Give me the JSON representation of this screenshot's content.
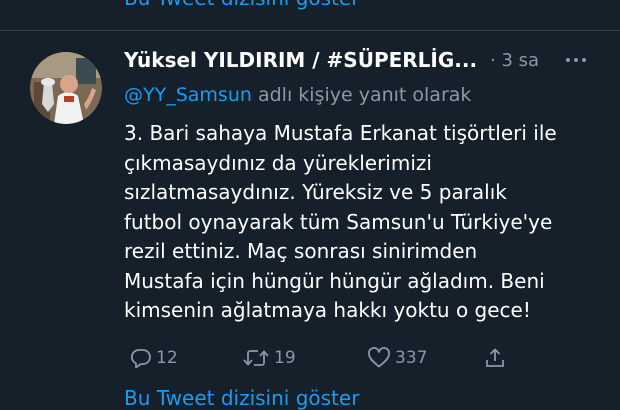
{
  "thread": {
    "top_link": "Bu Tweet dizisini göster",
    "bottom_link": "Bu Tweet dizisini göster"
  },
  "tweet": {
    "author_name": "Yüksel YILDIRIM / #SÜPERLİG...",
    "timestamp": "· 3 sa",
    "reply_prefix": "@YY_Samsun",
    "reply_suffix": " adlı kişiye yanıt olarak",
    "text_lines": [
      "3. Bari sahaya Mustafa Erkanat tişörtleri ile",
      "çıkmasaydınız da yüreklerimizi",
      "sızlatmasaydınız. Yüreksiz ve 5 paralık",
      "futbol oynayarak tüm Samsun'u Türkiye'ye",
      "rezil ettiniz. Maç sonrası sinirimden",
      "Mustafa için hüngür hüngür ağladım. Beni",
      "kimsenin ağlatmaya hakkı yoktu o gece!"
    ],
    "actions": {
      "replies": "12",
      "retweets": "19",
      "likes": "337"
    }
  },
  "icons": {
    "more": "more-horizontal-icon",
    "reply": "reply-icon",
    "retweet": "retweet-icon",
    "like": "heart-icon",
    "share": "share-icon"
  },
  "colors": {
    "background": "#15202b",
    "accent": "#1d9bf0",
    "secondary_text": "#8b98a5",
    "primary_text": "#ffffff",
    "divider": "#38444d"
  }
}
